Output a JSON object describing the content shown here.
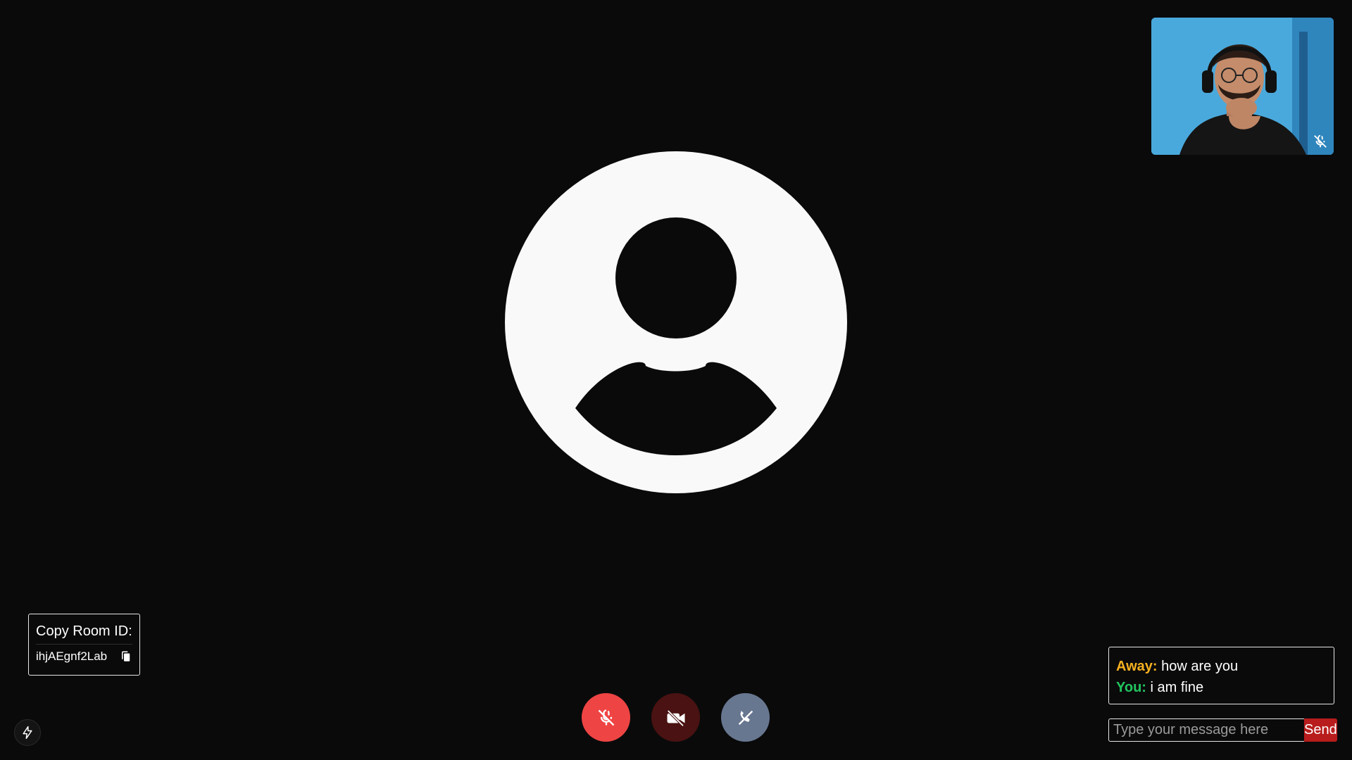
{
  "room": {
    "title": "Copy Room ID:",
    "id": "ihjAEgnf2Lab",
    "copy_icon": "copy-icon"
  },
  "remote": {
    "avatar_icon": "user-placeholder-icon"
  },
  "self_view": {
    "mic_state": "muted",
    "mic_icon": "mic-off-icon"
  },
  "controls": [
    {
      "name": "mic-toggle",
      "icon": "mic-off-icon",
      "color": "#ef4444"
    },
    {
      "name": "camera-toggle",
      "icon": "video-off-icon",
      "color": "#4a1212"
    },
    {
      "name": "end-call",
      "icon": "phone-off-icon",
      "color": "#687790"
    }
  ],
  "chat": {
    "messages": [
      {
        "sender": "Away:",
        "text": "how are you",
        "sender_color": "#f5b120"
      },
      {
        "sender": "You:",
        "text": "i am fine",
        "sender_color": "#22c55e"
      }
    ],
    "input_value": "",
    "input_placeholder": "Type your message here",
    "send_label": "Send"
  },
  "misc": {
    "bolt_icon": "lightning-icon"
  },
  "colors": {
    "background": "#0a0a0b",
    "send_button": "#b91c1c"
  }
}
